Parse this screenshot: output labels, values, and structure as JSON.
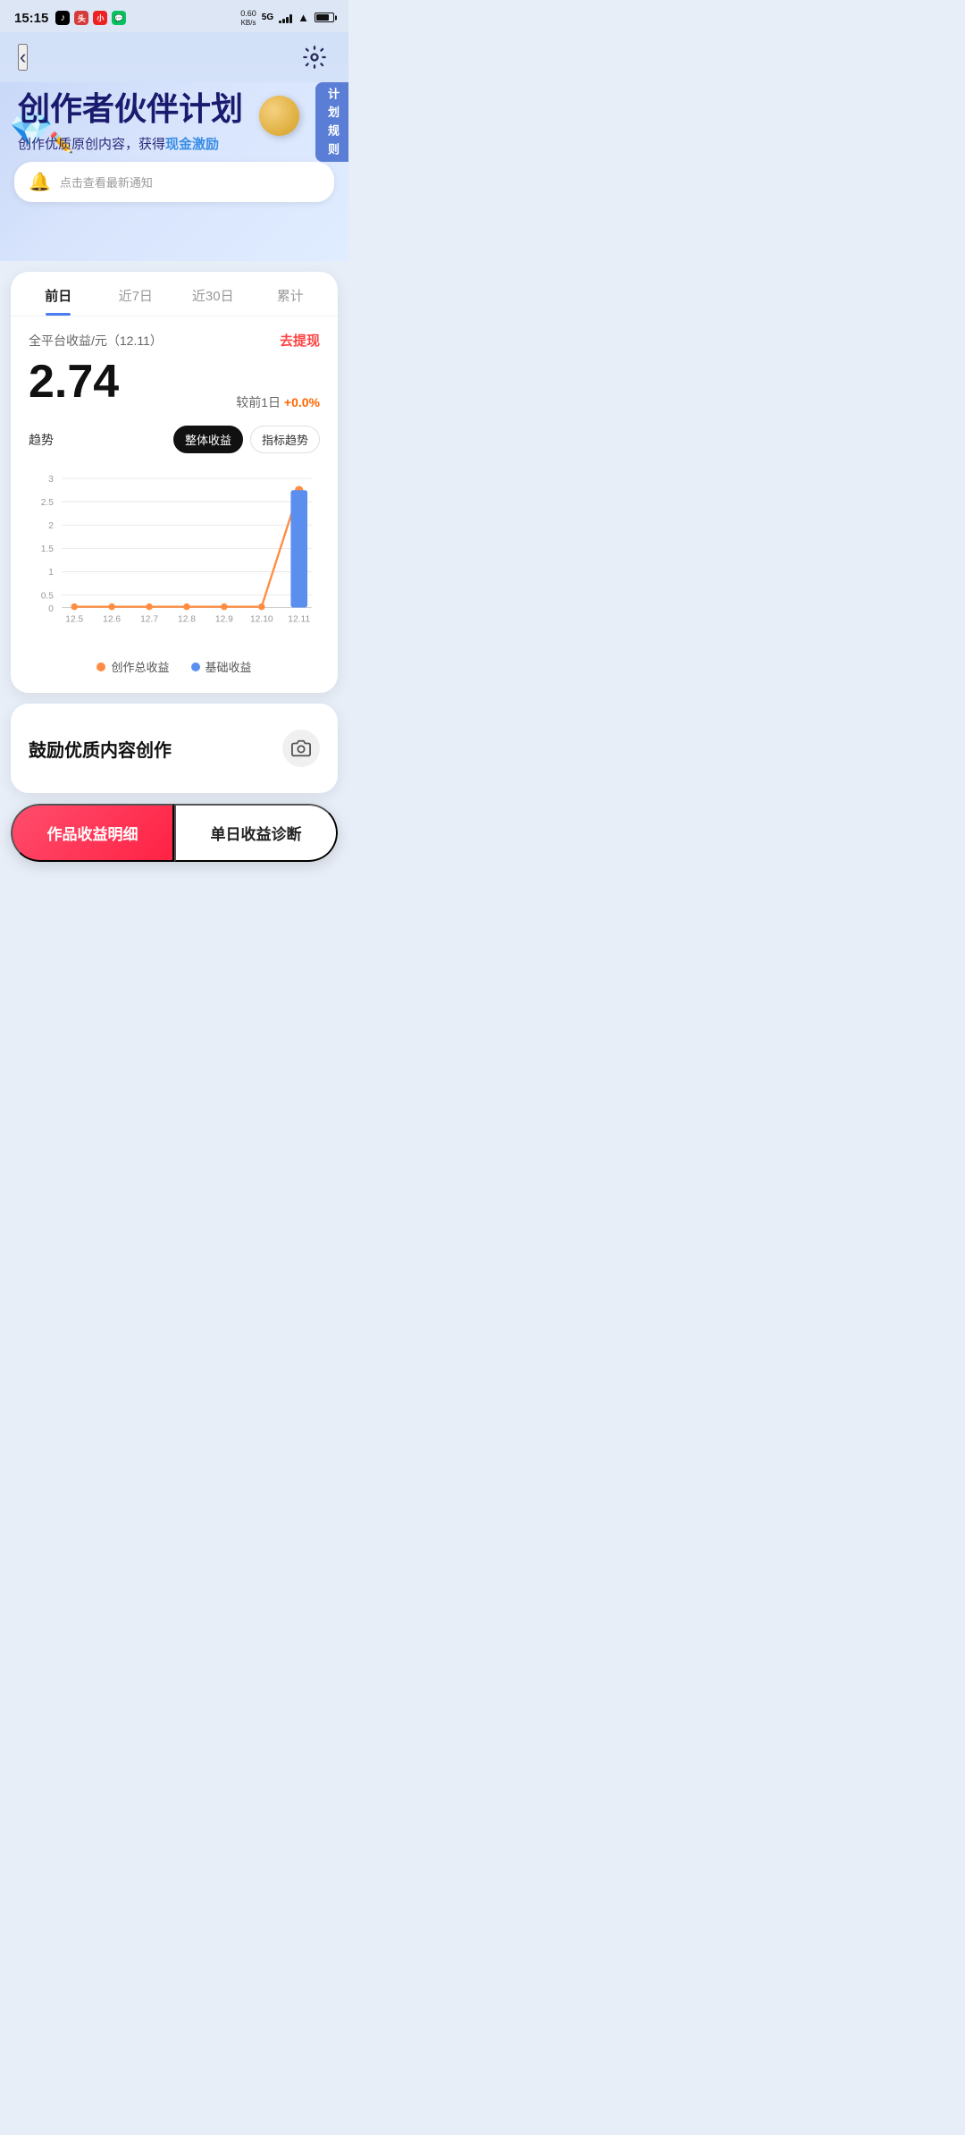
{
  "statusBar": {
    "time": "15:15",
    "network": "0.60\nKB/s",
    "networkType": "5G HD"
  },
  "header": {
    "backLabel": "‹",
    "settingsLabel": "⚙"
  },
  "heroBanner": {
    "title": "创作者伙伴计划",
    "subtitle": "创作优质原创内容，获得",
    "subtitleHighlight": "现金激励",
    "planRules": "计\n划\n规\n则"
  },
  "notification": {
    "text": "点击查看最新通知"
  },
  "tabs": [
    {
      "label": "前日",
      "active": true
    },
    {
      "label": "近7日",
      "active": false
    },
    {
      "label": "近30日",
      "active": false
    },
    {
      "label": "累计",
      "active": false
    }
  ],
  "earnings": {
    "label": "全平台收益/元（12.11）",
    "withdrawLabel": "去提现",
    "amount": "2.74",
    "changeLabel": "较前1日",
    "changeValue": "+0.0%",
    "trendLabel": "趋势",
    "overallBtn": "整体收益",
    "indexBtn": "指标趋势"
  },
  "chart": {
    "yLabels": [
      "3",
      "2.5",
      "2",
      "1.5",
      "1",
      "0.5",
      "0"
    ],
    "xLabels": [
      "12.5",
      "12.6",
      "12.7",
      "12.8",
      "12.9",
      "12.10",
      "12.11"
    ],
    "legend": {
      "totalLabel": "创作总收益",
      "baseLabel": "基础收益",
      "totalColor": "#ff8c40",
      "baseColor": "#5a8ff0"
    },
    "data": {
      "total": [
        0,
        0,
        0,
        0,
        0,
        0,
        2.74
      ],
      "base": [
        0,
        0,
        0,
        0,
        0,
        0,
        2.74
      ]
    }
  },
  "contentSection": {
    "title": "鼓励优质内容创作"
  },
  "bottomButtons": {
    "primaryLabel": "作品收益明细",
    "secondaryLabel": "单日收益诊断"
  }
}
